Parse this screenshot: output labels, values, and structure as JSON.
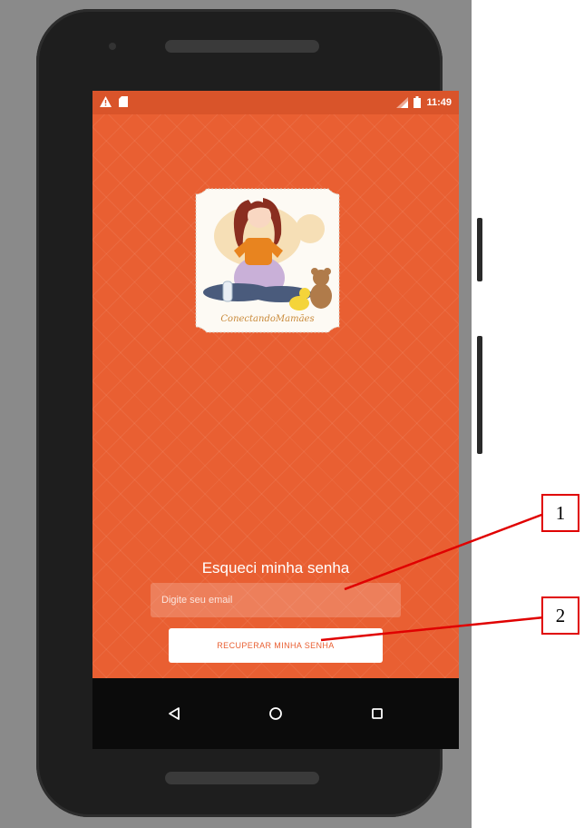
{
  "status_bar": {
    "time": "11:49",
    "left_icons": [
      "warning-icon",
      "sd-card-icon"
    ],
    "right_icons": [
      "signal-icon",
      "battery-icon"
    ]
  },
  "logo": {
    "script_text": "ConectandoMamães"
  },
  "forgot_password": {
    "title": "Esqueci minha senha",
    "email_placeholder": "Digite seu email",
    "email_value": "",
    "button_label": "RECUPERAR MINHA SENHA"
  },
  "nav_bar": {
    "icons": [
      "back-icon",
      "home-icon",
      "recents-icon"
    ]
  },
  "callouts": [
    {
      "label": "1"
    },
    {
      "label": "2"
    }
  ],
  "colors": {
    "primary": "#e95f32",
    "status_bar": "#d9542a",
    "nav_bar": "#0b0b0b",
    "callout": "#e00000"
  }
}
